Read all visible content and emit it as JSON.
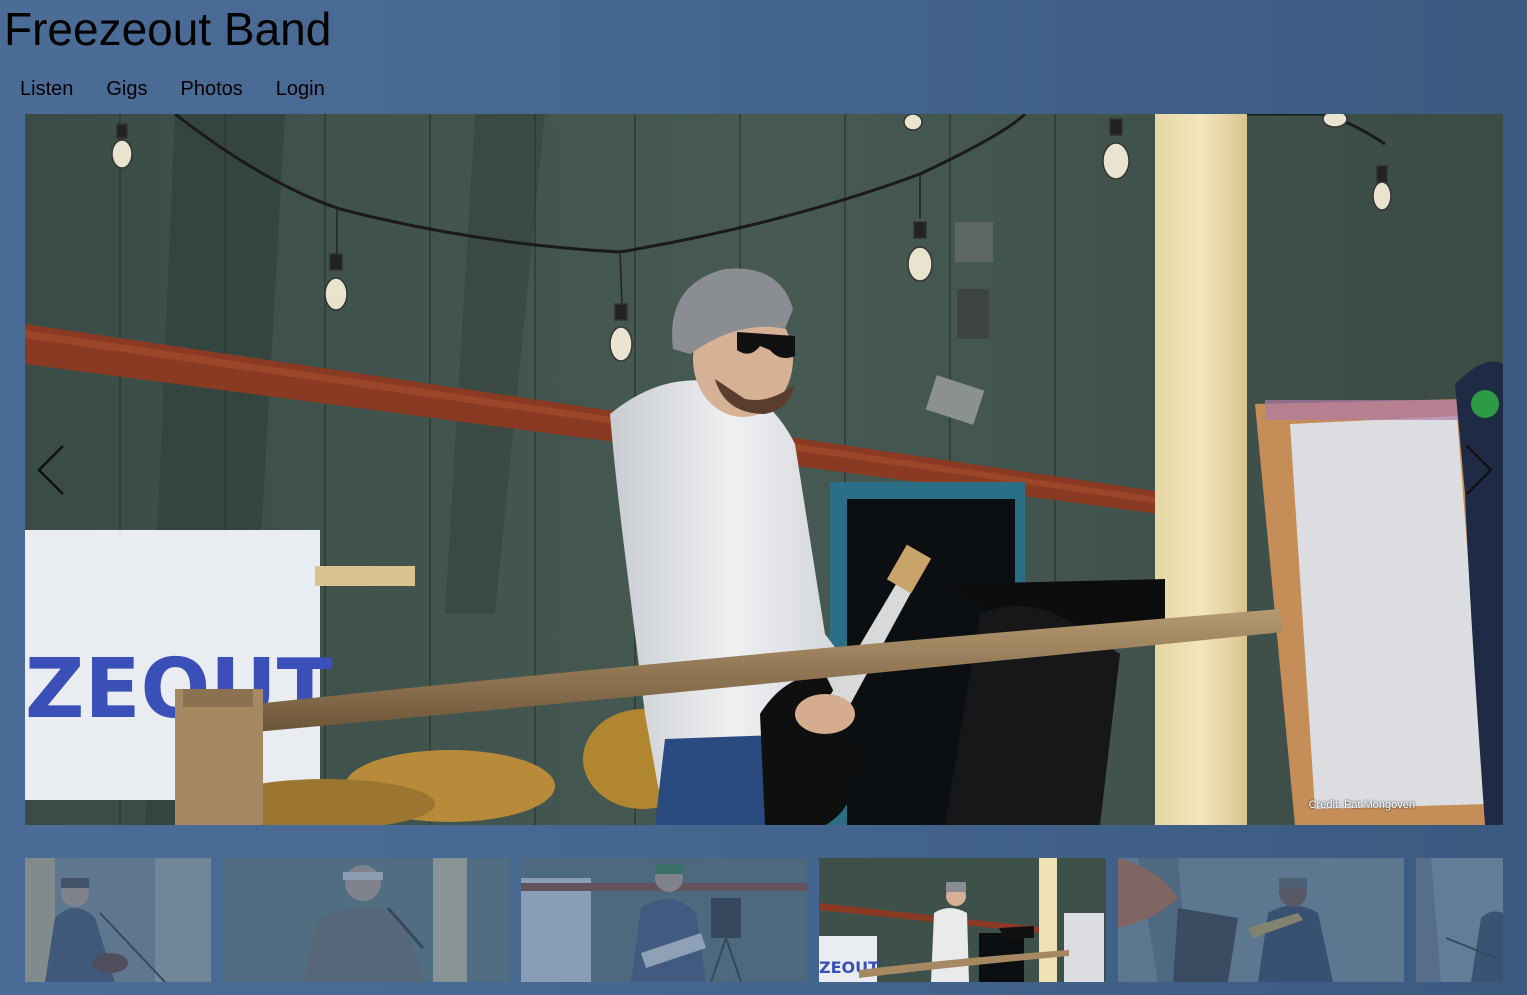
{
  "site": {
    "title": "Freezeout Band"
  },
  "nav": {
    "items": [
      {
        "label": "Listen"
      },
      {
        "label": "Gigs"
      },
      {
        "label": "Photos"
      },
      {
        "label": "Login"
      }
    ]
  },
  "slideshow": {
    "credit": "Credit: Pat Mongoven",
    "banner_text": "ZEOUT",
    "prev_icon": "chevron-left-icon",
    "next_icon": "chevron-right-icon",
    "active_index": 3
  },
  "thumbnails": [
    {
      "name": "guitarist-singer-cap"
    },
    {
      "name": "singer-headband"
    },
    {
      "name": "guitarist-green-cap"
    },
    {
      "name": "bassist-beanie"
    },
    {
      "name": "trumpet-player"
    },
    {
      "name": "partial-musician"
    }
  ],
  "colors": {
    "background": "#466890",
    "text": "#000000",
    "credit": "#ffffff"
  }
}
